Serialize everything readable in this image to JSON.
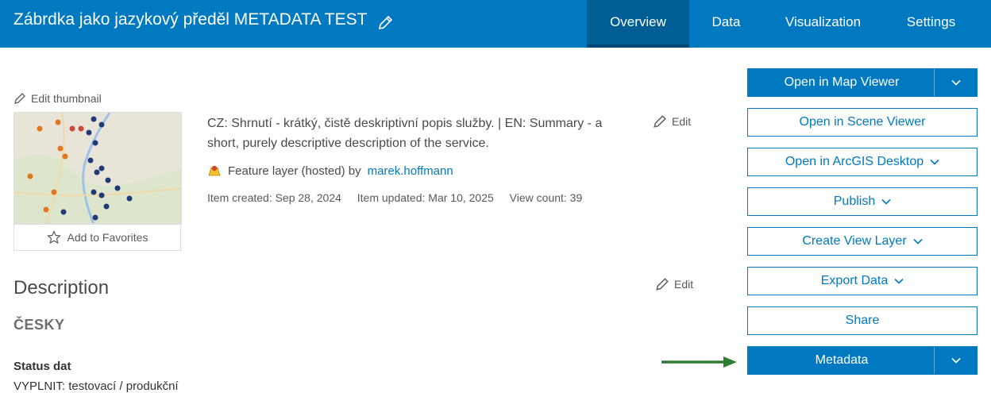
{
  "header": {
    "title": "Zábrdka jako jazykový předěl METADATA TEST",
    "tabs": [
      {
        "label": "Overview",
        "active": true
      },
      {
        "label": "Data",
        "active": false
      },
      {
        "label": "Visualization",
        "active": false
      },
      {
        "label": "Settings",
        "active": false
      }
    ]
  },
  "thumbnail": {
    "edit_label": "Edit thumbnail",
    "favorites_label": "Add to Favorites"
  },
  "summary": {
    "text": "CZ: Shrnutí - krátký, čistě deskriptivní popis služby. | EN: Summary - a short, purely descriptive description of the service.",
    "edit_label": "Edit",
    "type_prefix": "Feature layer (hosted) by",
    "owner": "marek.hoffmann",
    "created": "Item created: Sep 28, 2024",
    "updated": "Item updated: Mar 10, 2025",
    "views": "View count: 39"
  },
  "description": {
    "heading": "Description",
    "edit_label": "Edit",
    "language": "ČESKY",
    "status_heading": "Status dat",
    "status_value": "VYPLNIT: testovací / produkční"
  },
  "actions": {
    "open_map_viewer": "Open in Map Viewer",
    "open_scene_viewer": "Open in Scene Viewer",
    "open_desktop": "Open in ArcGIS Desktop",
    "publish": "Publish",
    "create_view_layer": "Create View Layer",
    "export_data": "Export Data",
    "share": "Share",
    "metadata": "Metadata"
  },
  "colors": {
    "brand": "#0079c1",
    "active_tab": "#005e95",
    "arrow": "#2e7d32"
  }
}
